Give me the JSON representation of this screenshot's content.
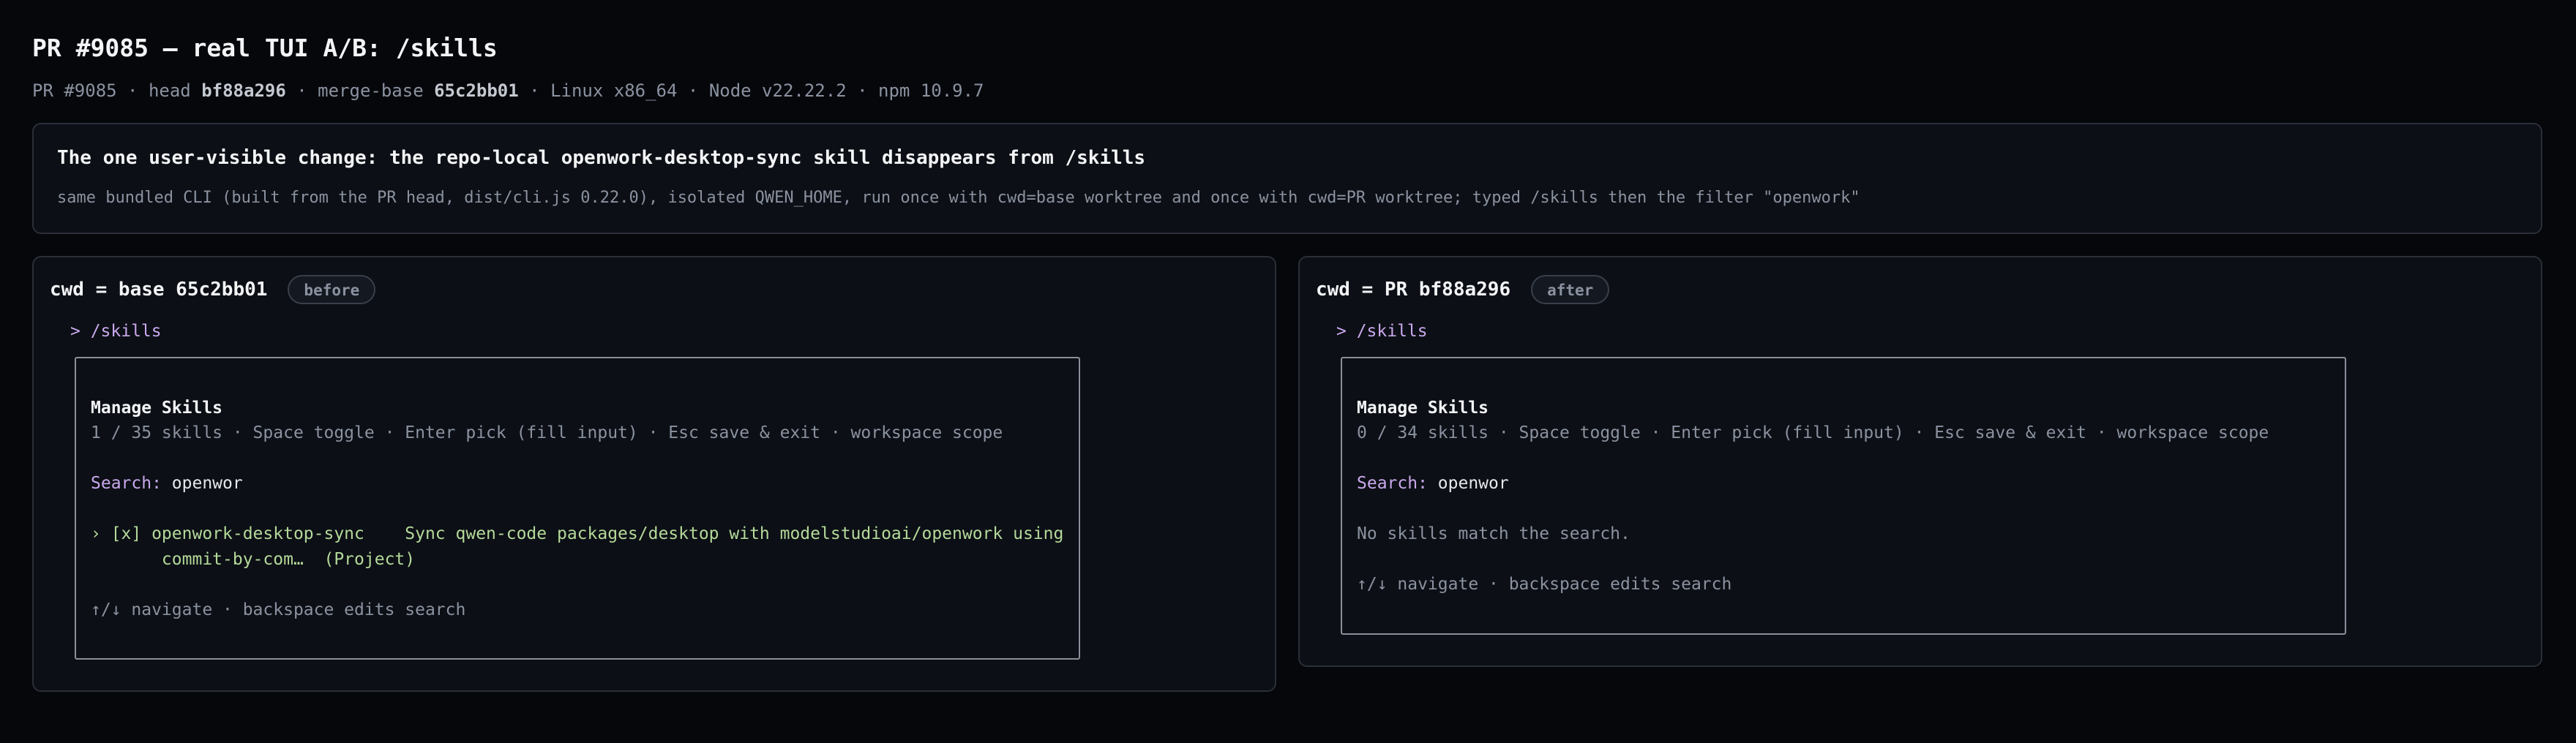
{
  "page": {
    "title": "PR #9085 — real TUI A/B: /skills",
    "meta": {
      "pr": "PR #9085",
      "sep": " · ",
      "head_label": "head ",
      "head_sha": "bf88a296",
      "merge_base_label": "merge-base ",
      "merge_base_sha": "65c2bb01",
      "platform": "Linux x86_64",
      "node": "Node v22.22.2",
      "npm": "npm 10.9.7"
    }
  },
  "summary": {
    "headline": "The one user-visible change: the repo-local openwork-desktop-sync skill disappears from /skills",
    "detail": "same bundled CLI (built from the PR head, dist/cli.js 0.22.0), isolated QWEN_HOME, run once with cwd=base worktree and once with cwd=PR worktree; typed /skills then the filter \"openwork\""
  },
  "panels": {
    "before": {
      "title": "cwd = base 65c2bb01",
      "badge": "before",
      "prompt": "> /skills",
      "dialog_title": "Manage Skills",
      "status": "1 / 35 skills · Space toggle · Enter pick (fill input) · Esc save & exit · workspace scope",
      "search_label": "Search:",
      "search_value": " openwor",
      "item_line1": "› [x] openwork-desktop-sync    Sync qwen-code packages/desktop with modelstudioai/openwork using",
      "item_line2": "       commit-by-com…  (Project)",
      "help": "↑/↓ navigate · backspace edits search"
    },
    "after": {
      "title": "cwd = PR bf88a296",
      "badge": "after",
      "prompt": "> /skills",
      "dialog_title": "Manage Skills",
      "status": "0 / 34 skills · Space toggle · Enter pick (fill input) · Esc save & exit · workspace scope",
      "search_label": "Search:",
      "search_value": " openwor",
      "empty_message": "No skills match the search.",
      "help": "↑/↓ navigate · backspace edits search"
    }
  },
  "colors": {
    "background": "#05070b",
    "panel": "#0c0f15",
    "border": "#2a2f38",
    "accent_purple": "#c9a8ec",
    "match_green": "#b4d99a",
    "muted": "#8b92a0"
  }
}
